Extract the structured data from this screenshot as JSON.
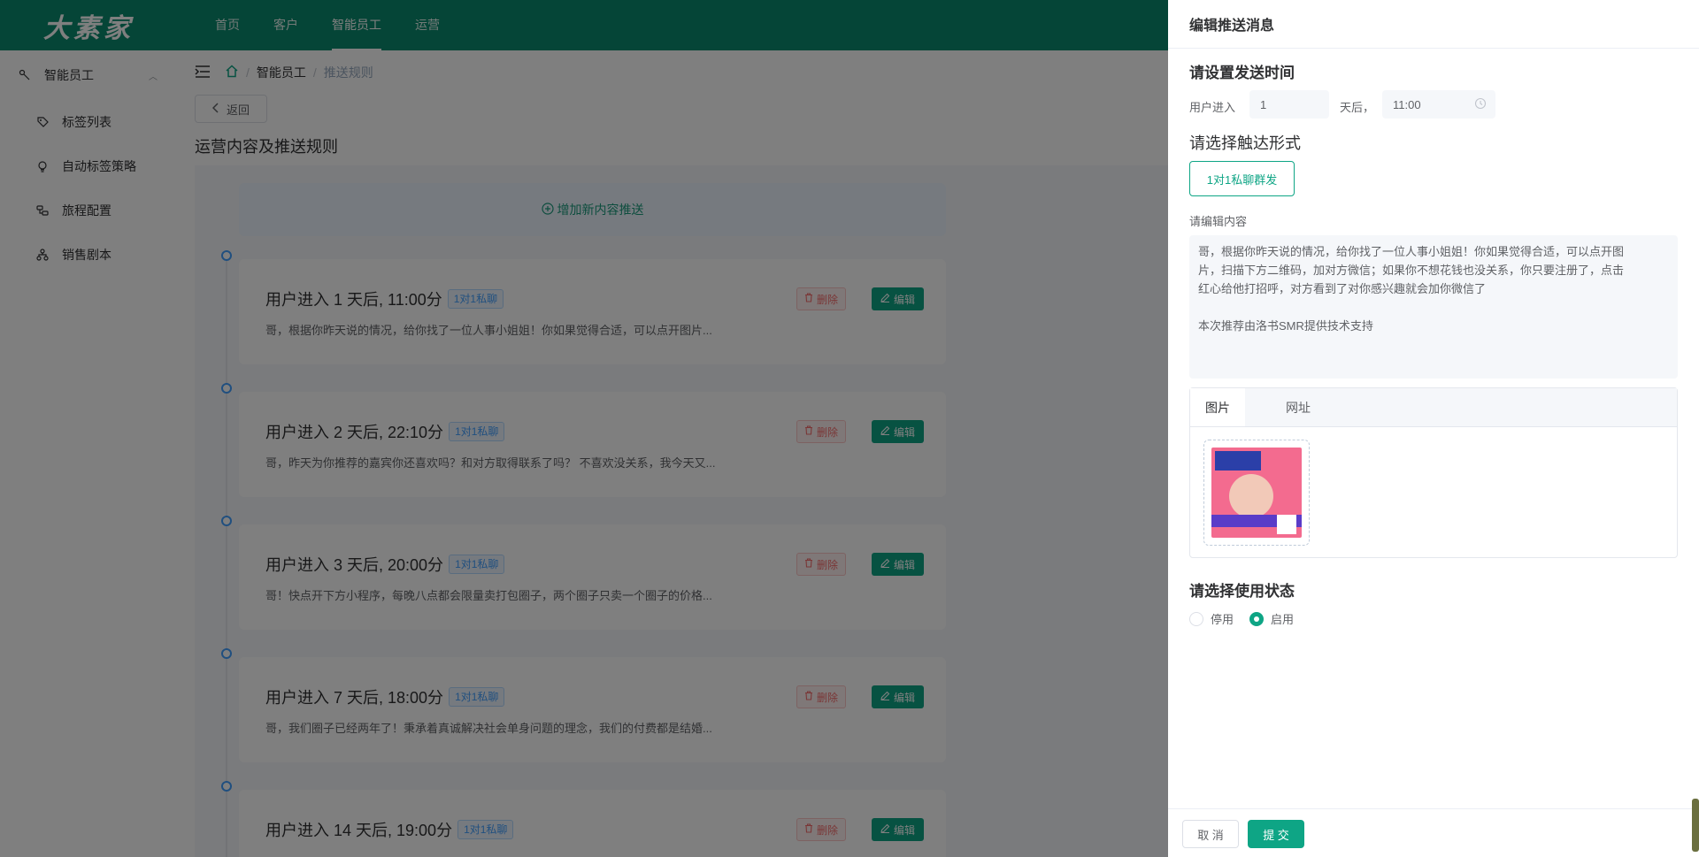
{
  "brand": {
    "logo_text": "大素家"
  },
  "topnav": [
    {
      "label": "首页"
    },
    {
      "label": "客户"
    },
    {
      "label": "智能员工"
    },
    {
      "label": "运营"
    }
  ],
  "sidebar": {
    "group_label": "智能员工",
    "items": [
      {
        "label": "标签列表"
      },
      {
        "label": "自动标签策略"
      },
      {
        "label": "旅程配置"
      },
      {
        "label": "销售剧本"
      }
    ]
  },
  "breadcrumb": {
    "items": [
      "智能员工",
      "推送规则"
    ]
  },
  "main": {
    "back_label": "返回",
    "page_title": "运营内容及推送规则",
    "add_label": "增加新内容推送",
    "delete_label": "删除",
    "edit_label": "编辑",
    "cards": [
      {
        "title": "用户进入 1 天后, 11:00分",
        "tag": "1对1私聊",
        "desc": "哥，根据你昨天说的情况，给你找了一位人事小姐姐！你如果觉得合适，可以点开图片..."
      },
      {
        "title": "用户进入 2 天后, 22:10分",
        "tag": "1对1私聊",
        "desc": "哥，昨天为你推荐的嘉宾你还喜欢吗？和对方取得联系了吗？ 不喜欢没关系，我今天又..."
      },
      {
        "title": "用户进入 3 天后, 20:00分",
        "tag": "1对1私聊",
        "desc": "哥！快点开下方小程序，每晚八点都会限量卖打包圈子，两个圈子只卖一个圈子的价格..."
      },
      {
        "title": "用户进入 7 天后, 18:00分",
        "tag": "1对1私聊",
        "desc": "哥，我们圈子已经两年了！秉承着真诚解决社会单身问题的理念，我们的付费都是结婚..."
      },
      {
        "title": "用户进入 14 天后, 19:00分",
        "tag": "1对1私聊",
        "desc": ""
      }
    ]
  },
  "drawer": {
    "title": "编辑推送消息",
    "time_section_title": "请设置发送时间",
    "user_enter_label": "用户进入",
    "days_value": "1",
    "days_after_label": "天后，",
    "time_value": "11:00",
    "reach_section_title": "请选择触达形式",
    "reach_option": "1对1私聊群发",
    "content_label": "请编辑内容",
    "content_lines": [
      "哥，根据你昨天说的情况，给你找了一位人事小姐姐！你如果觉得合适，可以点开图",
      "片，扫描下方二维码，加对方微信；如果你不想花钱也没关系，你只要注册了，点击",
      "红心给他打招呼，对方看到了对你感兴趣就会加你微信了",
      "",
      "本次推荐由洛书SMR提供技术支持"
    ],
    "tabs": [
      {
        "label": "图片"
      },
      {
        "label": "网址"
      }
    ],
    "status_section_title": "请选择使用状态",
    "status_options": [
      {
        "label": "停用"
      },
      {
        "label": "启用"
      }
    ],
    "selected_status": "启用",
    "cancel_label": "取 消",
    "submit_label": "提 交"
  },
  "colors": {
    "primary": "#0ea585",
    "topbar": "#0b8a6e",
    "danger": "#f56c6c",
    "info_blue": "#409eff"
  }
}
